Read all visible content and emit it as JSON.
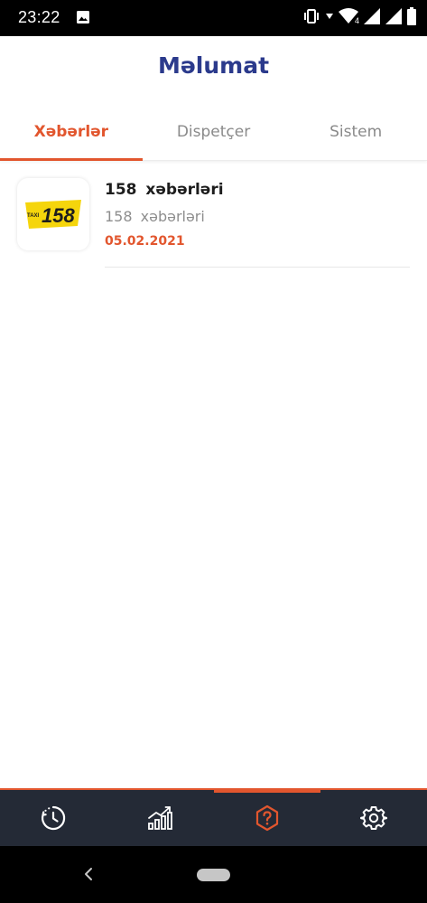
{
  "status_bar": {
    "time": "23:22",
    "network_badge": "4"
  },
  "header": {
    "title": "Məlumat"
  },
  "tabs": [
    {
      "label": "Xəbərlər",
      "active": true
    },
    {
      "label": "Dispetçer",
      "active": false
    },
    {
      "label": "Sistem",
      "active": false
    }
  ],
  "news": [
    {
      "logo_text": "158",
      "logo_small_text": "TAXI",
      "title": "158  xəbərləri",
      "subtitle": "158  xəbərləri",
      "date": "05.02.2021"
    }
  ],
  "bottom_nav": {
    "items": [
      {
        "icon": "history-icon",
        "active": false
      },
      {
        "icon": "stats-chart-icon",
        "active": false
      },
      {
        "icon": "help-icon",
        "active": true
      },
      {
        "icon": "settings-gear-icon",
        "active": false
      }
    ]
  },
  "colors": {
    "accent": "#e2562e",
    "title_blue": "#2b3a8c",
    "nav_bg": "#242a36",
    "logo_yellow": "#f5d50c"
  }
}
